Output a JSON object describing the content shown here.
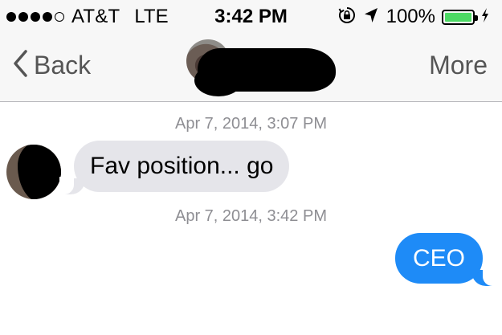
{
  "status_bar": {
    "signal_bars_filled": 4,
    "signal_bars_total": 5,
    "carrier": "AT&T",
    "network": "LTE",
    "time": "3:42 PM",
    "icons": [
      "orientation-lock-icon",
      "location-arrow-icon"
    ],
    "battery_percent": "100%",
    "battery_level": 1.0,
    "battery_color": "#4cd964"
  },
  "nav": {
    "back_label": "Back",
    "more_label": "More"
  },
  "conversation": {
    "messages": [
      {
        "timestamp": "Apr 7, 2014, 3:07 PM",
        "direction": "incoming",
        "text": "Fav position... go"
      },
      {
        "timestamp": "Apr 7, 2014, 3:42 PM",
        "direction": "outgoing",
        "text": "CEO"
      }
    ],
    "colors": {
      "incoming_bubble": "#e5e5ea",
      "outgoing_bubble": "#1e8bf7",
      "timestamp_text": "#8e8e93"
    }
  }
}
